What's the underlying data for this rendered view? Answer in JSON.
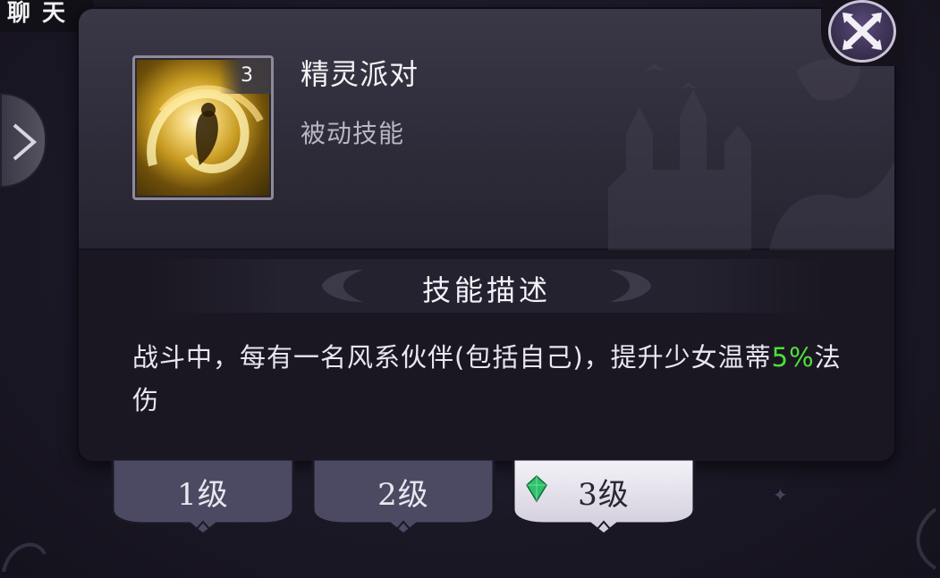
{
  "chat_tab": {
    "label": "聊 天"
  },
  "skill": {
    "name": "精灵派对",
    "type": "被动技能",
    "level_badge": "3"
  },
  "description": {
    "title": "技能描述",
    "text_part1": "战斗中，每有一名风系伙伴(包括自己)，提升少女温蒂",
    "highlight": "5%",
    "text_part2": "法伤"
  },
  "level_tabs": [
    {
      "label": "1级",
      "active": false
    },
    {
      "label": "2级",
      "active": false
    },
    {
      "label": "3级",
      "active": true
    }
  ],
  "colors": {
    "highlight": "#4ee03a",
    "panel_bg": "#1a1722",
    "active_tab": "#e9e6ef",
    "gem": "#2fc06a"
  },
  "icons": {
    "close": "close-x-icon",
    "expand": "chevron-right-icon",
    "gem": "green-gem-icon"
  }
}
